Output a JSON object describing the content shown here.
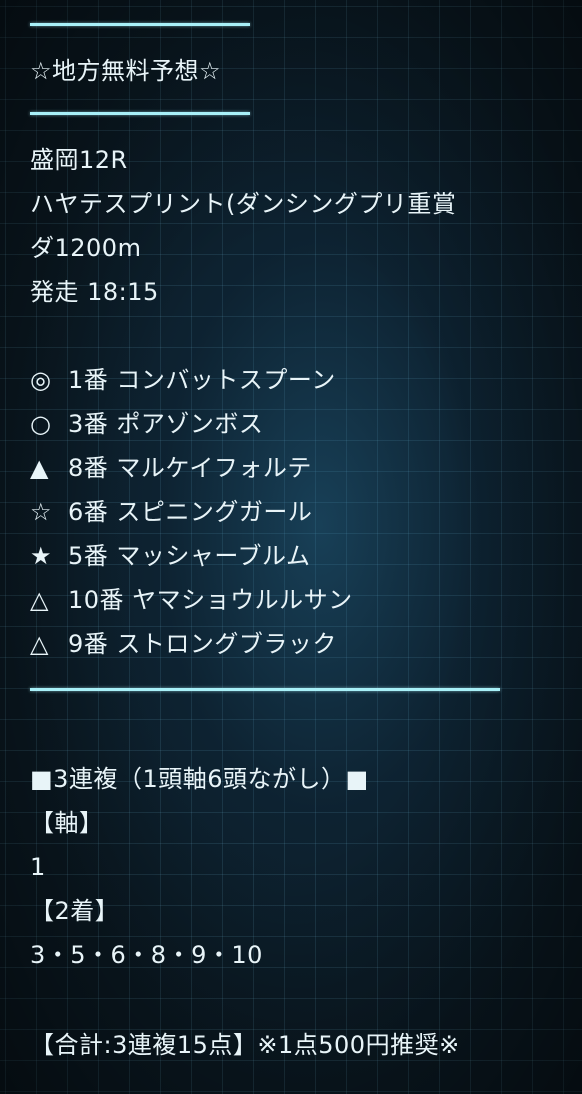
{
  "header": {
    "title": "☆地方無料予想☆"
  },
  "race": {
    "venue_race": "盛岡12R",
    "name": "ハヤテスプリント(ダンシングプリ重賞",
    "course": "ダ1200m",
    "start": "発走 18:15"
  },
  "picks": [
    {
      "mark": "◎",
      "text": "1番 コンバットスプーン"
    },
    {
      "mark": "○",
      "text": "3番 ポアゾンボス"
    },
    {
      "mark": "▲",
      "text": "8番 マルケイフォルテ"
    },
    {
      "mark": "☆",
      "text": "6番 スピニングガール"
    },
    {
      "mark": "★",
      "text": "5番 マッシャーブルム"
    },
    {
      "mark": "△",
      "text": "10番 ヤマショウルルサン"
    },
    {
      "mark": "△",
      "text": "9番 ストロングブラック"
    }
  ],
  "betting": {
    "type_heading": "■3連複（1頭軸6頭ながし）■",
    "axis_label": "【軸】",
    "axis_value": "1",
    "second_label": "【2着】",
    "second_value": "3・5・6・8・9・10",
    "total": "【合計:3連複15点】※1点500円推奨※"
  },
  "colors": {
    "rule": "#a8f0f8",
    "text": "#e8f4f8",
    "background": "#0b1a24"
  }
}
